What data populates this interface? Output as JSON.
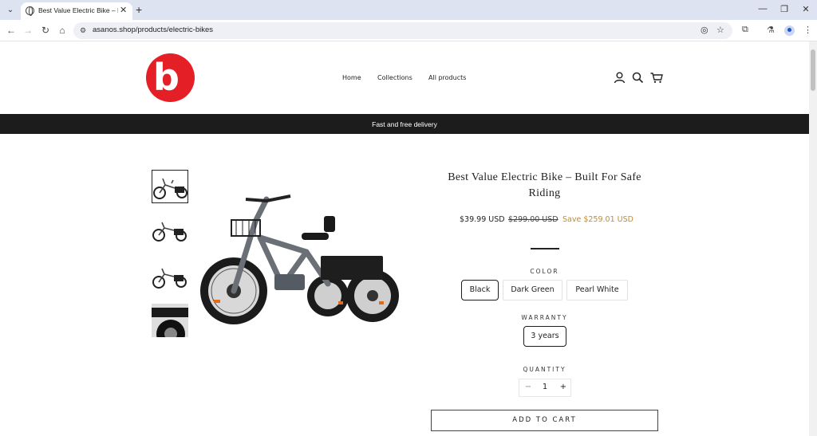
{
  "browser": {
    "tab_title": "Best Value Electric Bike – Built F",
    "url": "asanos.shop/products/electric-bikes"
  },
  "header": {
    "nav": [
      "Home",
      "Collections",
      "All products"
    ]
  },
  "banner": {
    "text": "Fast and free delivery"
  },
  "product": {
    "title": "Best Value Electric Bike – Built For Safe Riding",
    "price": "$39.99 USD",
    "compare_price": "$299.00 USD",
    "savings": "Save $259.01 USD",
    "color_label": "COLOR",
    "colors": [
      "Black",
      "Dark Green",
      "Pearl White"
    ],
    "selected_color": "Black",
    "warranty_label": "WARRANTY",
    "warranty_options": [
      "3 years"
    ],
    "quantity_label": "QUANTITY",
    "quantity": "1",
    "qty_minus": "−",
    "qty_plus": "+",
    "add_to_cart": "ADD TO CART"
  },
  "colors": {
    "accent_sale": "#c48a2a",
    "banner_bg": "#1c1c1c",
    "logo_red": "#e41f26"
  }
}
